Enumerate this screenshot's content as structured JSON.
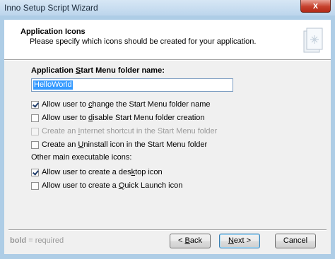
{
  "window": {
    "title": "Inno Setup Script Wizard",
    "close_glyph": "x"
  },
  "header": {
    "title": "Application Icons",
    "subtitle": "Please specify which icons should be created for your application."
  },
  "folder": {
    "label_pre": "Application ",
    "label_key": "S",
    "label_post": "tart Menu folder name:",
    "value": "HelloWorld"
  },
  "options": [
    {
      "pre": "Allow user to ",
      "key": "c",
      "post": "hange the Start Menu folder name",
      "checked": true,
      "disabled": false
    },
    {
      "pre": "Allow user to ",
      "key": "d",
      "post": "isable Start Menu folder creation",
      "checked": false,
      "disabled": false
    },
    {
      "pre": "Create an ",
      "key": "I",
      "post": "nternet shortcut in the Start Menu folder",
      "checked": false,
      "disabled": true
    },
    {
      "pre": "Create an ",
      "key": "U",
      "post": "ninstall icon in the Start Menu folder",
      "checked": false,
      "disabled": false
    }
  ],
  "other_section": {
    "label": "Other main executable icons:"
  },
  "other_options": [
    {
      "pre": "Allow user to create a des",
      "key": "k",
      "post": "top icon",
      "checked": true
    },
    {
      "pre": "Allow user to create a ",
      "key": "Q",
      "post": "uick Launch icon",
      "checked": false
    }
  ],
  "footer": {
    "hint_bold": "bold",
    "hint_rest": " = required",
    "back": {
      "pre": "< ",
      "key": "B",
      "post": "ack"
    },
    "next": {
      "key": "N",
      "post": "ext >"
    },
    "cancel": "Cancel"
  }
}
